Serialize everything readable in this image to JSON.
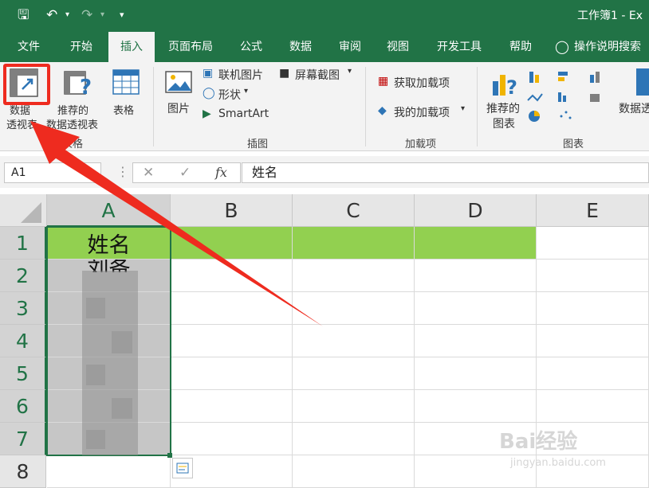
{
  "titlebar": {
    "save_icon": "save-icon",
    "undo_icon": "undo-icon",
    "redo_icon": "redo-icon",
    "title": "工作簿1 - Ex"
  },
  "tabs": [
    "文件",
    "开始",
    "插入",
    "页面布局",
    "公式",
    "数据",
    "审阅",
    "视图",
    "开发工具",
    "帮助"
  ],
  "tell_me": "操作说明搜索",
  "ribbon": {
    "tables": {
      "pivot_line1": "数据",
      "pivot_line2": "透视表",
      "recommended_line1": "推荐的",
      "recommended_line2": "数据透视表",
      "table": "表格",
      "group": "表格"
    },
    "illustrations": {
      "pictures": "图片",
      "online_pictures": "联机图片",
      "shapes": "形状",
      "smartart": "SmartArt",
      "screenshot": "屏幕截图",
      "group": "插图"
    },
    "addins": {
      "get_addins": "获取加载项",
      "my_addins": "我的加载项",
      "group": "加载项"
    },
    "charts": {
      "recommended_line1": "推荐的",
      "recommended_line2": "图表",
      "pivotchart": "数据透",
      "group": "图表"
    }
  },
  "formula_bar": {
    "name_box": "A1",
    "fx": "fx",
    "content": "姓名"
  },
  "columns": [
    "A",
    "B",
    "C",
    "D",
    "E"
  ],
  "rows": [
    "1",
    "2",
    "3",
    "4",
    "5",
    "6",
    "7",
    "8"
  ],
  "cells": {
    "A1": "姓名",
    "A2_partial": "刘备"
  },
  "colors": {
    "excel_green": "#217346",
    "header_fill": "#92d050",
    "annotation_red": "#ee2b1f"
  },
  "watermark": {
    "brand": "Bai经验",
    "url": "jingyan.baidu.com"
  }
}
